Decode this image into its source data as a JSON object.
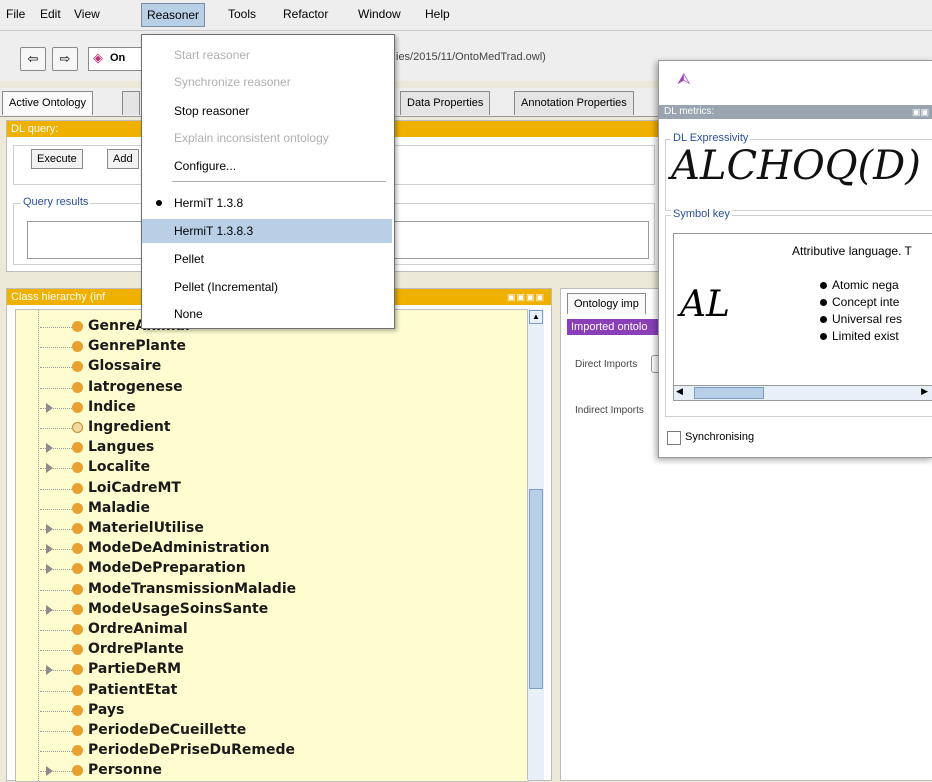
{
  "menubar": {
    "items": [
      "File",
      "Edit",
      "View",
      "Reasoner",
      "Tools",
      "Refactor",
      "Window",
      "Help"
    ]
  },
  "toolbar": {
    "ontology_label": "On",
    "path_text": "ies/2015/11/OntoMedTrad.owl)"
  },
  "tabs": [
    "Active Ontology",
    "Data Properties",
    "Annotation Properties"
  ],
  "dl_query": {
    "title": "DL query:",
    "execute": "Execute",
    "add": "Add",
    "results_label": "Query results"
  },
  "class_hierarchy": {
    "title": "Class hierarchy (inf",
    "items": [
      {
        "label": "GenreAnimal",
        "expand": false,
        "hollow": false
      },
      {
        "label": "GenrePlante",
        "expand": false,
        "hollow": false
      },
      {
        "label": "Glossaire",
        "expand": false,
        "hollow": false
      },
      {
        "label": "Iatrogenese",
        "expand": false,
        "hollow": false
      },
      {
        "label": "Indice",
        "expand": true,
        "hollow": false
      },
      {
        "label": "Ingredient",
        "expand": false,
        "hollow": true
      },
      {
        "label": "Langues",
        "expand": true,
        "hollow": false
      },
      {
        "label": "Localite",
        "expand": true,
        "hollow": false
      },
      {
        "label": "LoiCadreMT",
        "expand": false,
        "hollow": false
      },
      {
        "label": "Maladie",
        "expand": false,
        "hollow": false
      },
      {
        "label": "MaterielUtilise",
        "expand": true,
        "hollow": false
      },
      {
        "label": "ModeDeAdministration",
        "expand": true,
        "hollow": false
      },
      {
        "label": "ModeDePreparation",
        "expand": true,
        "hollow": false
      },
      {
        "label": "ModeTransmissionMaladie",
        "expand": false,
        "hollow": false
      },
      {
        "label": "ModeUsageSoinsSante",
        "expand": true,
        "hollow": false
      },
      {
        "label": "OrdreAnimal",
        "expand": false,
        "hollow": false
      },
      {
        "label": "OrdrePlante",
        "expand": false,
        "hollow": false
      },
      {
        "label": "PartieDeRM",
        "expand": true,
        "hollow": false
      },
      {
        "label": "PatientEtat",
        "expand": false,
        "hollow": false
      },
      {
        "label": "Pays",
        "expand": false,
        "hollow": false
      },
      {
        "label": "PeriodeDeCueillette",
        "expand": false,
        "hollow": false
      },
      {
        "label": "PeriodeDePriseDuRemede",
        "expand": false,
        "hollow": false
      },
      {
        "label": "Personne",
        "expand": true,
        "hollow": false
      }
    ]
  },
  "imports": {
    "tab": "Ontology imp",
    "header": "Imported ontolo",
    "direct": "Direct Imports",
    "indirect": "Indirect Imports"
  },
  "reasoner_menu": {
    "items": [
      {
        "label": "Start reasoner",
        "state": "disabled"
      },
      {
        "label": "Synchronize reasoner",
        "state": "disabled"
      },
      {
        "label": "Stop reasoner",
        "state": "enabled"
      },
      {
        "label": "Explain inconsistent ontology",
        "state": "disabled"
      },
      {
        "label": "Configure...",
        "state": "enabled"
      },
      {
        "label": "HermiT 1.3.8",
        "state": "selected"
      },
      {
        "label": "HermiT 1.3.8.3",
        "state": "highlighted"
      },
      {
        "label": "Pellet",
        "state": "enabled"
      },
      {
        "label": "Pellet (Incremental)",
        "state": "enabled"
      },
      {
        "label": "None",
        "state": "enabled"
      }
    ]
  },
  "dl_metrics": {
    "title": "DL metrics:",
    "expressivity_label": "DL Expressivity",
    "expressivity": "ALCHOQ(D)",
    "symbol_key_label": "Symbol key",
    "symbol": "AL",
    "description": "Attributive language. T",
    "bullets": [
      "Atomic nega",
      "Concept inte",
      "Universal res",
      "Limited exist"
    ],
    "sync_label": "Synchronising"
  },
  "colors": {
    "accent": "#b8cfe5",
    "dl_header": "#f0b000",
    "imports_header": "#8a3fb8",
    "tree_bg": "#fdfdd0",
    "class_dot": "#e8a030"
  }
}
